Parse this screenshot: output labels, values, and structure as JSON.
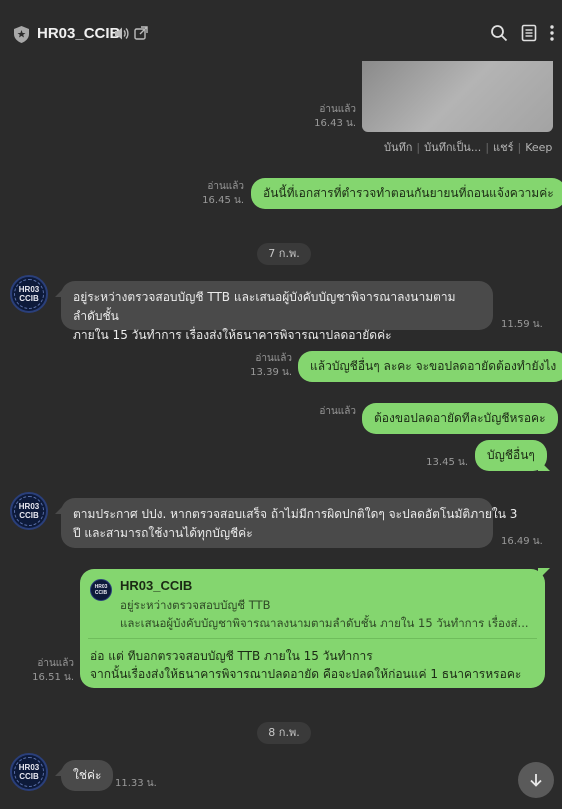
{
  "header": {
    "title": "HR03_CCIB",
    "icons": [
      "shield-icon",
      "speaker-icon",
      "open-external-icon",
      "search-icon",
      "notes-icon",
      "more-icon"
    ]
  },
  "image_message": {
    "read_label": "อ่านแล้ว",
    "time": "16.43 น.",
    "actions": [
      "บันทึก",
      "บันทึกเป็น...",
      "แชร์",
      "Keep"
    ]
  },
  "messages": [
    {
      "id": "m1",
      "side": "out",
      "text": "อันนี้ที่เอกสารที่ตำรวจทำตอนกันยายนที่ถอนแจ้งความค่ะ",
      "read": "อ่านแล้ว",
      "time": "16.45 น."
    },
    {
      "id": "m2",
      "side": "in",
      "line1": "อยู่ระหว่างตรวจสอบบัญชี TTB และเสนอผู้บังคับบัญชาพิจารณาลงนามตามลำดับชั้น",
      "line2": "ภายใน 15 วันทำการ เรื่องส่งให้ธนาคารพิจารณาปลดอายัดค่ะ",
      "time": "11.59 น."
    },
    {
      "id": "m3",
      "side": "out",
      "text": "แล้วบัญชีอื่นๆ ละคะ จะขอปลดอายัดต้องทำยังไง",
      "read": "อ่านแล้ว",
      "time": "13.39 น."
    },
    {
      "id": "m4",
      "side": "out",
      "text": "ต้องขอปลดอายัดทีละบัญชีหรอคะ",
      "read": "อ่านแล้ว",
      "time": ""
    },
    {
      "id": "m5",
      "side": "out",
      "text": "บัญชีอื่นๆ",
      "read": "",
      "time": "13.45 น."
    },
    {
      "id": "m6",
      "side": "in",
      "line1": "ตามประกาศ ปปง. หากตรวจสอบเสร็จ ถ้าไม่มีการผิดปกติใดๆ จะปลดอัตโนมัติภายใน 3",
      "line2": "ปี และสามารถใช้งานได้ทุกบัญชีค่ะ",
      "time": "16.49 น."
    },
    {
      "id": "m7",
      "side": "in",
      "text": "ใช่ค่ะ",
      "time": "11.33 น."
    }
  ],
  "reply_message": {
    "quote_name": "HR03_CCIB",
    "quote_line1": "อยู่ระหว่างตรวจสอบบัญชี TTB",
    "quote_line2": "และเสนอผู้บังคับบัญชาพิจารณาลงนามตามลำดับชั้น ภายใน 15 วันทำการ เรื่องส่...",
    "body_line1": "อ่อ แต่ ทีบอกตรวจสอบบัญชี TTB ภายใน 15 วันทำการ",
    "body_line2": "จากนั้นเรื่องส่งให้ธนาคารพิจารณาปลดอายัด คือจะปลดให้ก่อนแค่ 1 ธนาคารหรอคะ",
    "read": "อ่านแล้ว",
    "time": "16.51 น."
  },
  "dates": {
    "d1": "7 ก.พ.",
    "d2": "8 ก.พ."
  },
  "avatar": {
    "text_top": "HR03",
    "text_bottom": "CCIB"
  },
  "colors": {
    "background": "#2b2b2b",
    "outgoing": "#84d66f",
    "incoming": "#4a4a4a"
  }
}
